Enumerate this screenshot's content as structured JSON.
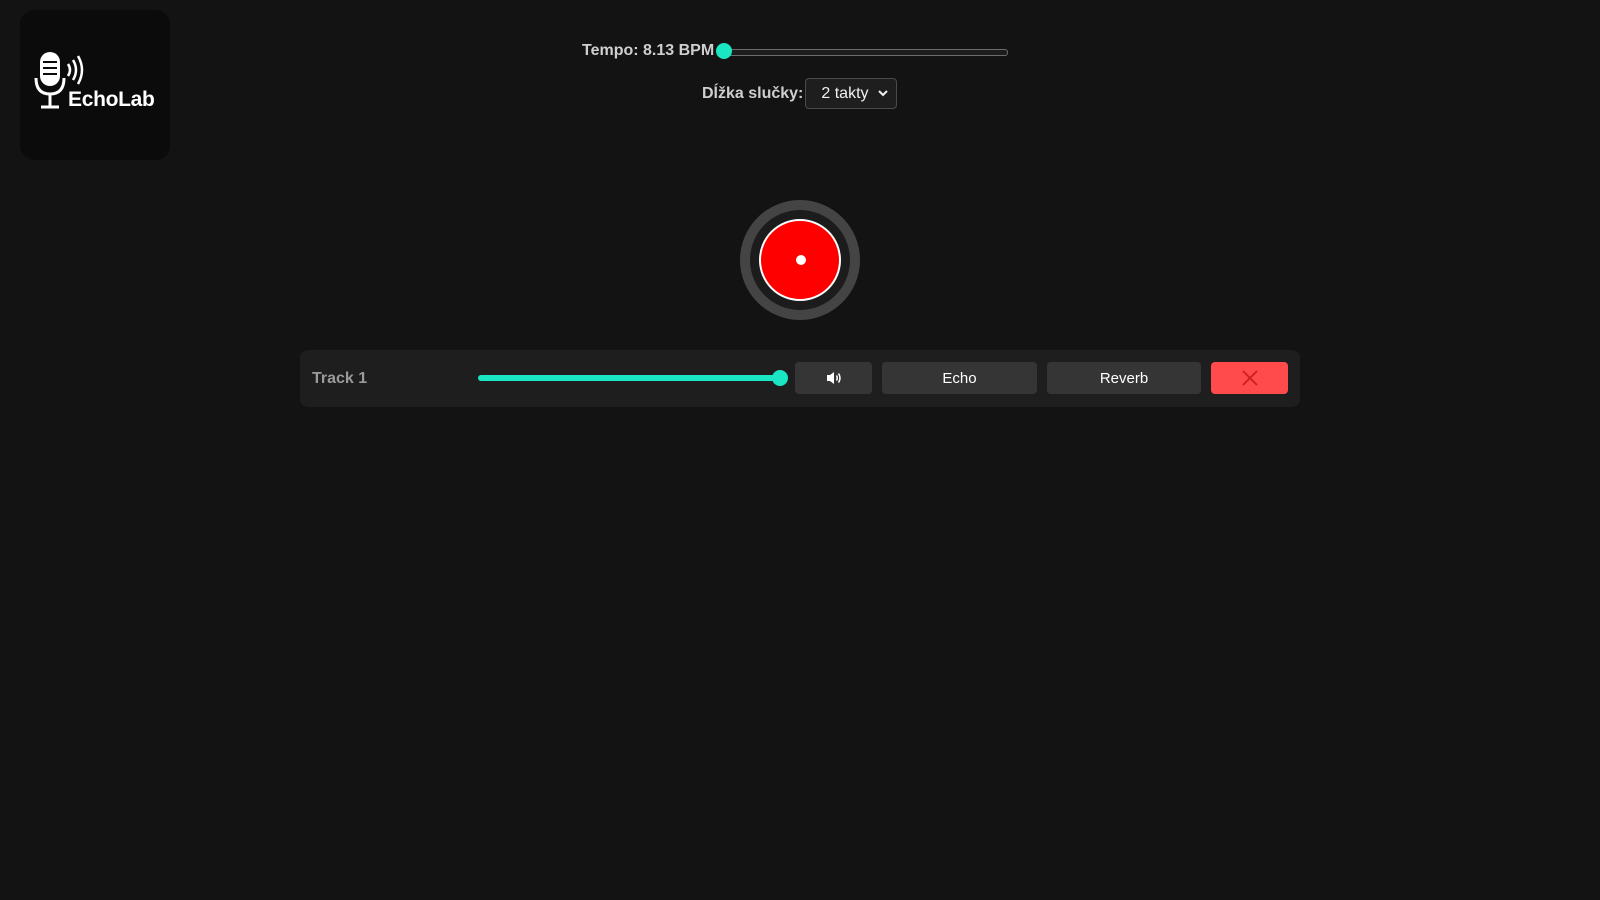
{
  "app": {
    "logo_text": "EchoLab"
  },
  "tempo": {
    "label": "Tempo: 8.13 BPM",
    "slider_fraction": 0.0
  },
  "loop": {
    "label": "Dĺžka slučky:",
    "selected": "2 takty"
  },
  "record": {
    "icon": "record-icon"
  },
  "tracks": [
    {
      "name": "Track 1",
      "volume_fraction": 1.0,
      "mute_icon": "speaker-icon",
      "echo_label": "Echo",
      "reverb_label": "Reverb",
      "delete_icon": "close-icon"
    }
  ],
  "colors": {
    "accent": "#1ae6c4",
    "record": "#ff0000",
    "delete": "#ff4b4b",
    "background": "#131313",
    "panel": "#1e1e1e"
  }
}
